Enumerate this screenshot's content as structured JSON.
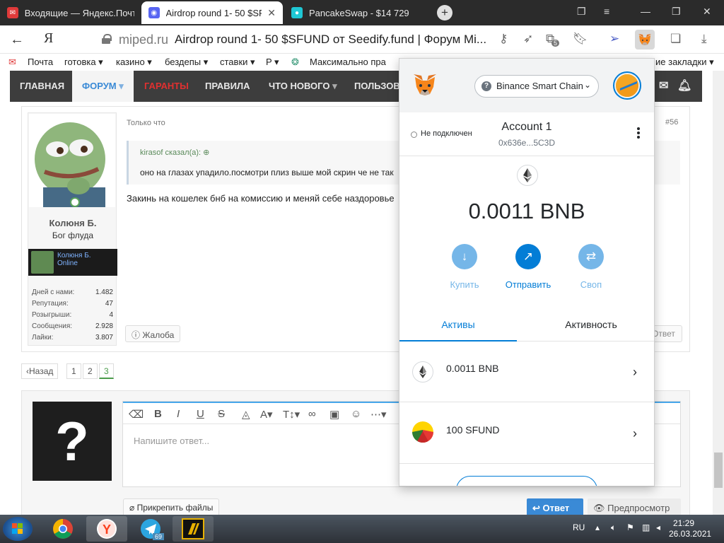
{
  "browser": {
    "tabs": [
      {
        "label": "Входящие — Яндекс.Почт",
        "icon": "mail-icon"
      },
      {
        "label": "Airdrop round 1- 50 $SF",
        "icon": "discord-like-icon"
      },
      {
        "label": "PancakeSwap - $14 729",
        "icon": "pancake-icon"
      }
    ],
    "domain": "miped.ru",
    "page_title": "Airdrop round 1- 50 $SFUND от Seedify.fund | Форум Mi...",
    "tab_count_badge": "5",
    "ya_logo": "Я"
  },
  "bookmarks": {
    "items": [
      "Почта",
      "готовка ▾",
      "казино ▾",
      "бездепы ▾",
      "ставки ▾",
      "P ▾",
      "Максимально пра"
    ],
    "other": "ие закладки ▾"
  },
  "site_nav": {
    "items": [
      "ГЛАВНАЯ",
      "ФОРУМ",
      "ГАРАНТЫ",
      "ПРАВИЛА",
      "ЧТО НОВОГО",
      "ПОЛЬЗОВ"
    ]
  },
  "post": {
    "time": "Только что",
    "number": "#56",
    "quote_author": "kirasof сказал(а): ⊕",
    "quote_text": "оно на глазах упадило.посмотри плиз выше мой скрин че не так",
    "text": "Закинь на кошелек бнб на комиссию и меняй себе наздоровье",
    "complaint": "ⓘ Жалоба",
    "reply": "Ответ",
    "user": {
      "name": "Колюня Б.",
      "rank": "Бог флуда",
      "bar_name": "Колюня Б.",
      "bar_status": "Online",
      "stats": [
        {
          "label": "Дней с нами:",
          "value": "1.482"
        },
        {
          "label": "Репутация:",
          "value": "47"
        },
        {
          "label": "Розыгрыши:",
          "value": "4"
        },
        {
          "label": "Сообщения:",
          "value": "2.928"
        },
        {
          "label": "Лайки:",
          "value": "3.807"
        }
      ]
    }
  },
  "pager": {
    "prev": "‹Назад",
    "pages": [
      "1",
      "2",
      "3"
    ],
    "current": "3"
  },
  "reply_editor": {
    "placeholder": "Напишите ответ...",
    "attach": "Прикрепить файлы",
    "send": "Ответ",
    "preview": "Предпросмотр",
    "avatar_glyph": "?"
  },
  "metamask": {
    "network": "Binance Smart Chain",
    "connection": "Не подключен",
    "account_name": "Account 1",
    "account_address": "0x636e...5C3D",
    "balance": "0.0011 BNB",
    "actions": [
      {
        "label": "Купить",
        "color": "#75b6e8",
        "glyph": "↓"
      },
      {
        "label": "Отправить",
        "color": "#037dd6",
        "glyph": "↗"
      },
      {
        "label": "Своп",
        "color": "#75b6e8",
        "glyph": "⇄"
      }
    ],
    "tabs": [
      "Активы",
      "Активность"
    ],
    "assets": [
      {
        "name": "0.0011 BNB",
        "icon": "eth-icon"
      },
      {
        "name": "100 SFUND",
        "icon": "sfund-icon"
      }
    ],
    "accent": "#037dd6"
  },
  "taskbar": {
    "lang": "RU",
    "time": "21:29",
    "date": "26.03.2021",
    "telegram_badge": "69"
  }
}
